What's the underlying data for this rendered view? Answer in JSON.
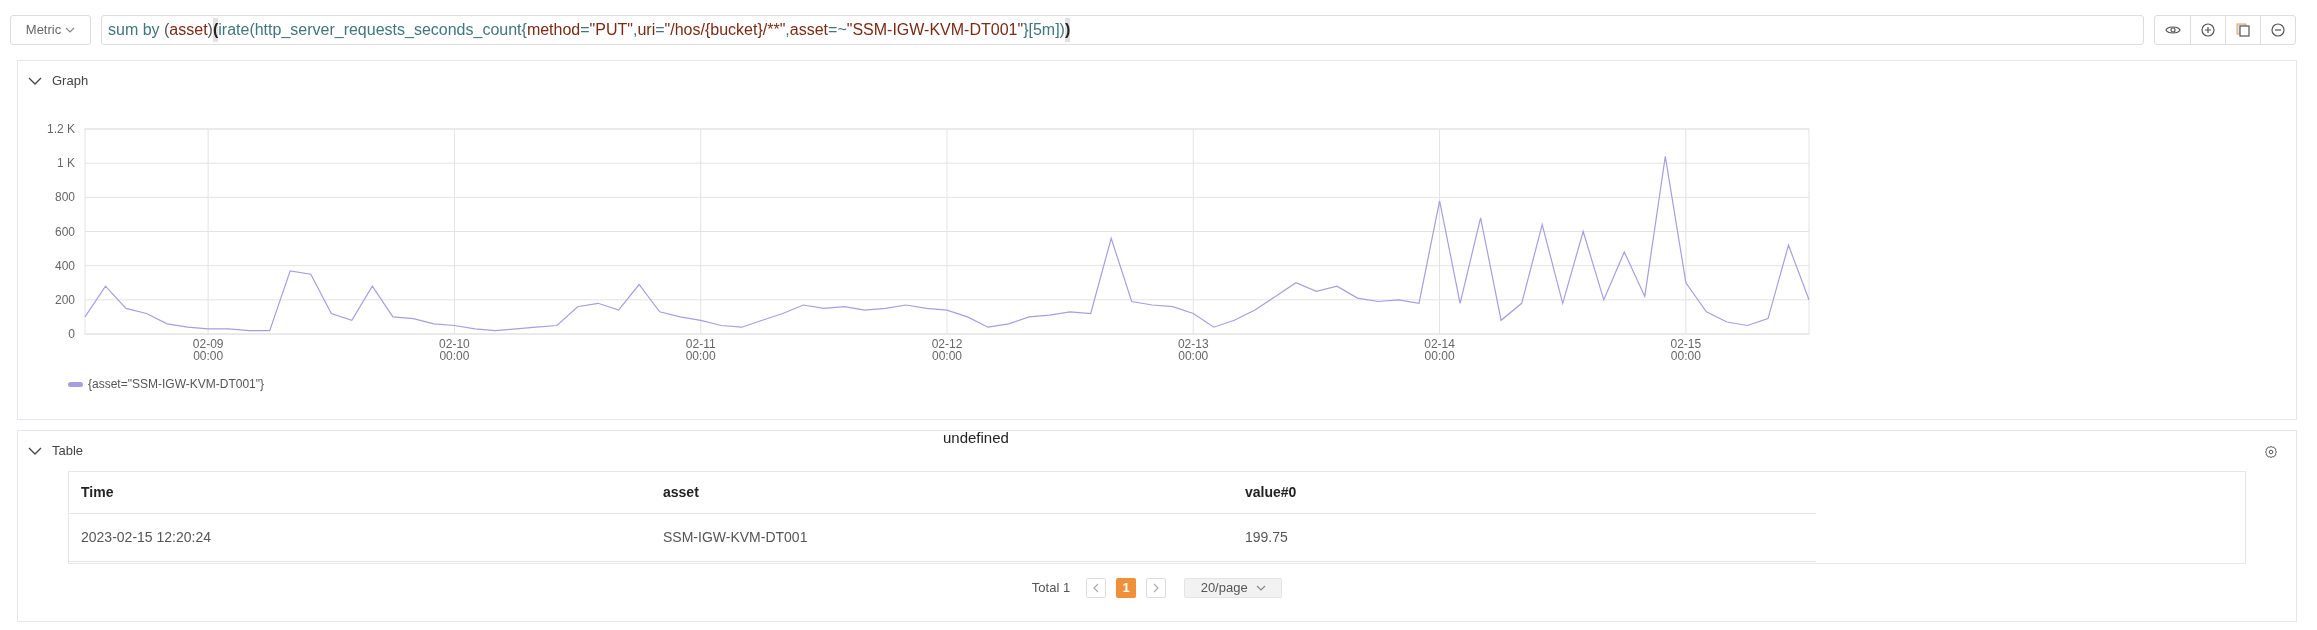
{
  "query_bar": {
    "metric_dropdown": "Metric",
    "query_tokens": [
      {
        "text": "sum by ",
        "kind": "keyword"
      },
      {
        "text": "(",
        "kind": "paren"
      },
      {
        "text": "asset",
        "kind": "label"
      },
      {
        "text": ")",
        "kind": "paren"
      },
      {
        "text": "(",
        "kind": "matched-paren"
      },
      {
        "text": "irate(http_server_requests_seconds_count{",
        "kind": "plain"
      },
      {
        "text": "method",
        "kind": "label"
      },
      {
        "text": "=",
        "kind": "plain"
      },
      {
        "text": "\"PUT\"",
        "kind": "string"
      },
      {
        "text": ",",
        "kind": "plain"
      },
      {
        "text": "uri",
        "kind": "label"
      },
      {
        "text": "=",
        "kind": "plain"
      },
      {
        "text": "\"/hos/{bucket}/**\"",
        "kind": "string"
      },
      {
        "text": ",",
        "kind": "plain"
      },
      {
        "text": "asset",
        "kind": "label"
      },
      {
        "text": "=~",
        "kind": "plain"
      },
      {
        "text": "\"SSM-IGW-KVM-DT001\"",
        "kind": "string"
      },
      {
        "text": "}",
        "kind": "plain"
      },
      {
        "text": "[5m]",
        "kind": "duration"
      },
      {
        "text": ")",
        "kind": "plain"
      },
      {
        "text": ")",
        "kind": "matched-paren"
      }
    ],
    "actions": [
      {
        "kind": "eye"
      },
      {
        "kind": "plus"
      },
      {
        "kind": "copy"
      },
      {
        "kind": "minus"
      }
    ]
  },
  "graph_panel": {
    "title": "Graph",
    "chart_data": {
      "type": "line",
      "grid": true,
      "ylim": [
        0,
        1200
      ],
      "yticks": [
        0,
        200,
        400,
        600,
        800,
        {
          "value": 1000,
          "label": "1 K"
        },
        {
          "value": 1200,
          "label": "1.2 K"
        }
      ],
      "categories": [
        null,
        null,
        null,
        null,
        null,
        null,
        "02-09 00:00",
        null,
        null,
        null,
        null,
        null,
        null,
        null,
        null,
        null,
        null,
        null,
        "02-10 00:00",
        null,
        null,
        null,
        null,
        null,
        null,
        null,
        null,
        null,
        null,
        null,
        "02-11 00:00",
        null,
        null,
        null,
        null,
        null,
        null,
        null,
        null,
        null,
        null,
        null,
        "02-12 00:00",
        null,
        null,
        null,
        null,
        null,
        null,
        null,
        null,
        null,
        null,
        null,
        "02-13 00:00",
        null,
        null,
        null,
        null,
        null,
        null,
        null,
        null,
        null,
        null,
        null,
        "02-14 00:00",
        null,
        null,
        null,
        null,
        null,
        null,
        null,
        null,
        null,
        null,
        null,
        "02-15 00:00",
        null,
        null,
        null,
        null,
        null,
        null
      ],
      "series": [
        {
          "name": "{asset=\"SSM-IGW-KVM-DT001\"}",
          "color": "#a99de0",
          "values": [
            100,
            280,
            150,
            120,
            60,
            40,
            30,
            30,
            20,
            20,
            370,
            350,
            120,
            80,
            280,
            100,
            90,
            60,
            50,
            30,
            20,
            30,
            40,
            50,
            160,
            180,
            140,
            290,
            130,
            100,
            80,
            50,
            40,
            80,
            120,
            170,
            150,
            160,
            140,
            150,
            170,
            150,
            140,
            100,
            40,
            60,
            100,
            110,
            130,
            120,
            560,
            190,
            170,
            160,
            120,
            40,
            80,
            140,
            220,
            300,
            250,
            280,
            210,
            190,
            200,
            180,
            780,
            180,
            680,
            80,
            180,
            640,
            180,
            600,
            200,
            480,
            220,
            1040,
            300,
            130,
            70,
            50,
            90,
            520,
            200
          ]
        }
      ]
    }
  },
  "overlay_text": "undefined",
  "table_panel": {
    "title": "Table",
    "columns": [
      "Time",
      "asset",
      "value#0"
    ],
    "rows": [
      [
        "2023-02-15 12:20:24",
        "SSM-IGW-KVM-DT001",
        "199.75"
      ]
    ],
    "pagination": {
      "total": "Total 1",
      "pages": [
        {
          "label": "1",
          "selected": true
        }
      ],
      "page_size": "20/page"
    }
  }
}
